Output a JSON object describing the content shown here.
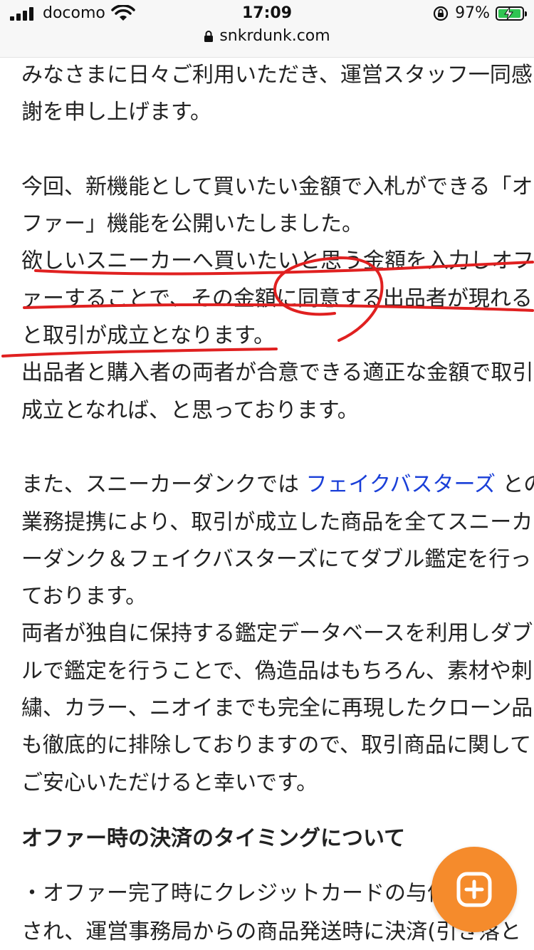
{
  "status_bar": {
    "carrier": "docomo",
    "time": "17:09",
    "battery_percent": "97%",
    "battery_level": 0.97,
    "charging": true
  },
  "browser": {
    "domain": "snkrdunk.com"
  },
  "article": {
    "paragraph1": [
      "みなさまに日々ご利用いただき、運営スタッフ一同感",
      "謝を申し上げます。"
    ],
    "paragraph2": [
      "今回、新機能として買いたい金額で入札ができる「オ",
      "ファー」機能を公開いたしました。",
      "欲しいスニーカーへ買いたいと思う金額を入力しオフ",
      "ァーすることで、その金額に同意する出品者が現れる",
      "と取引が成立となります。",
      "出品者と購入者の両者が合意できる適正な金額で取引",
      "成立となれば、と思っております。"
    ],
    "paragraph3": {
      "line1_before": "また、スニーカーダンクでは",
      "link_text": "フェイクバスターズ",
      "line1_after": "との",
      "lines": [
        "業務提携により、取引が成立した商品を全てスニーカ",
        "ーダンク＆フェイクバスターズにてダブル鑑定を行っ",
        "ております。",
        "両者が独自に保持する鑑定データベースを利用しダブ",
        "ルで鑑定を行うことで、偽造品はもちろん、素材や刺",
        "繍、カラー、ニオイまでも完全に再現したクローン品",
        "も徹底的に排除しておりますので、取引商品に関して",
        "ご安心いただけると幸いです。"
      ]
    },
    "heading": "オファー時の決済のタイミングについて",
    "bullet_lines": [
      "・オファー完了時にクレジットカードの与信枠",
      "され、運営事務局からの商品発送時に決済(引き落と"
    ]
  },
  "colors": {
    "link": "#1a3fd8",
    "annotation_red": "#e02020",
    "fab_orange": "#f58b2c"
  },
  "icons": {
    "fab": "plus-square-icon"
  }
}
